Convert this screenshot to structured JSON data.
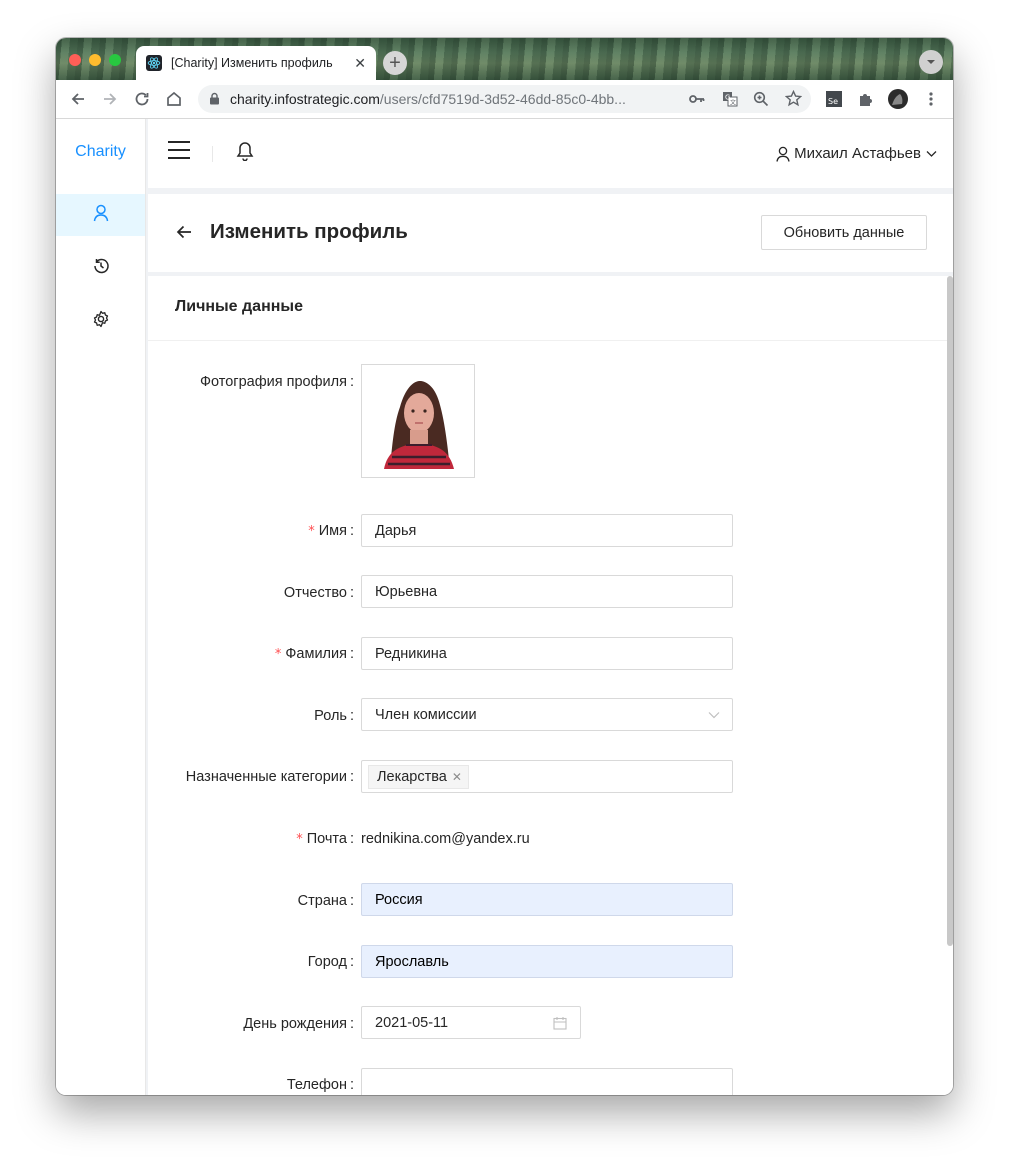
{
  "browser": {
    "tab_title": "[Charity] Изменить профиль",
    "tab_close": "✕",
    "new_tab": "+",
    "url_host": "charity.infostrategic.com",
    "url_path": "/users/cfd7519d-3d52-46dd-85c0-4bb..."
  },
  "sidebar": {
    "logo": "Charity",
    "items": [
      {
        "icon": "user-icon",
        "active": true
      },
      {
        "icon": "history-icon",
        "active": false
      },
      {
        "icon": "settings-icon",
        "active": false
      }
    ]
  },
  "header": {
    "user_name": "Михаил Астафьев"
  },
  "page_header": {
    "title": "Изменить профиль",
    "update_button": "Обновить данные"
  },
  "card": {
    "title": "Личные данные"
  },
  "form": {
    "photo_label": "Фотография профиля",
    "first_name": {
      "label": "Имя",
      "value": "Дарья",
      "required": true
    },
    "middle_name": {
      "label": "Отчество",
      "value": "Юрьевна",
      "required": false
    },
    "last_name": {
      "label": "Фамилия",
      "value": "Редникина",
      "required": true
    },
    "role": {
      "label": "Роль",
      "value": "Член комиссии"
    },
    "categories": {
      "label": "Назначенные категории",
      "tags": [
        "Лекарства"
      ]
    },
    "email": {
      "label": "Почта",
      "value": "rednikina.com@yandex.ru",
      "required": true
    },
    "country": {
      "label": "Страна",
      "value": "Россия"
    },
    "city": {
      "label": "Город",
      "value": "Ярославль"
    },
    "birthday": {
      "label": "День рождения",
      "value": "2021-05-11"
    },
    "phone": {
      "label": "Телефон",
      "value": ""
    },
    "colon": ":",
    "required_mark": "*"
  },
  "colors": {
    "accent": "#1890ff",
    "required": "#ff4d4f",
    "autofill": "#e8f0fe"
  }
}
